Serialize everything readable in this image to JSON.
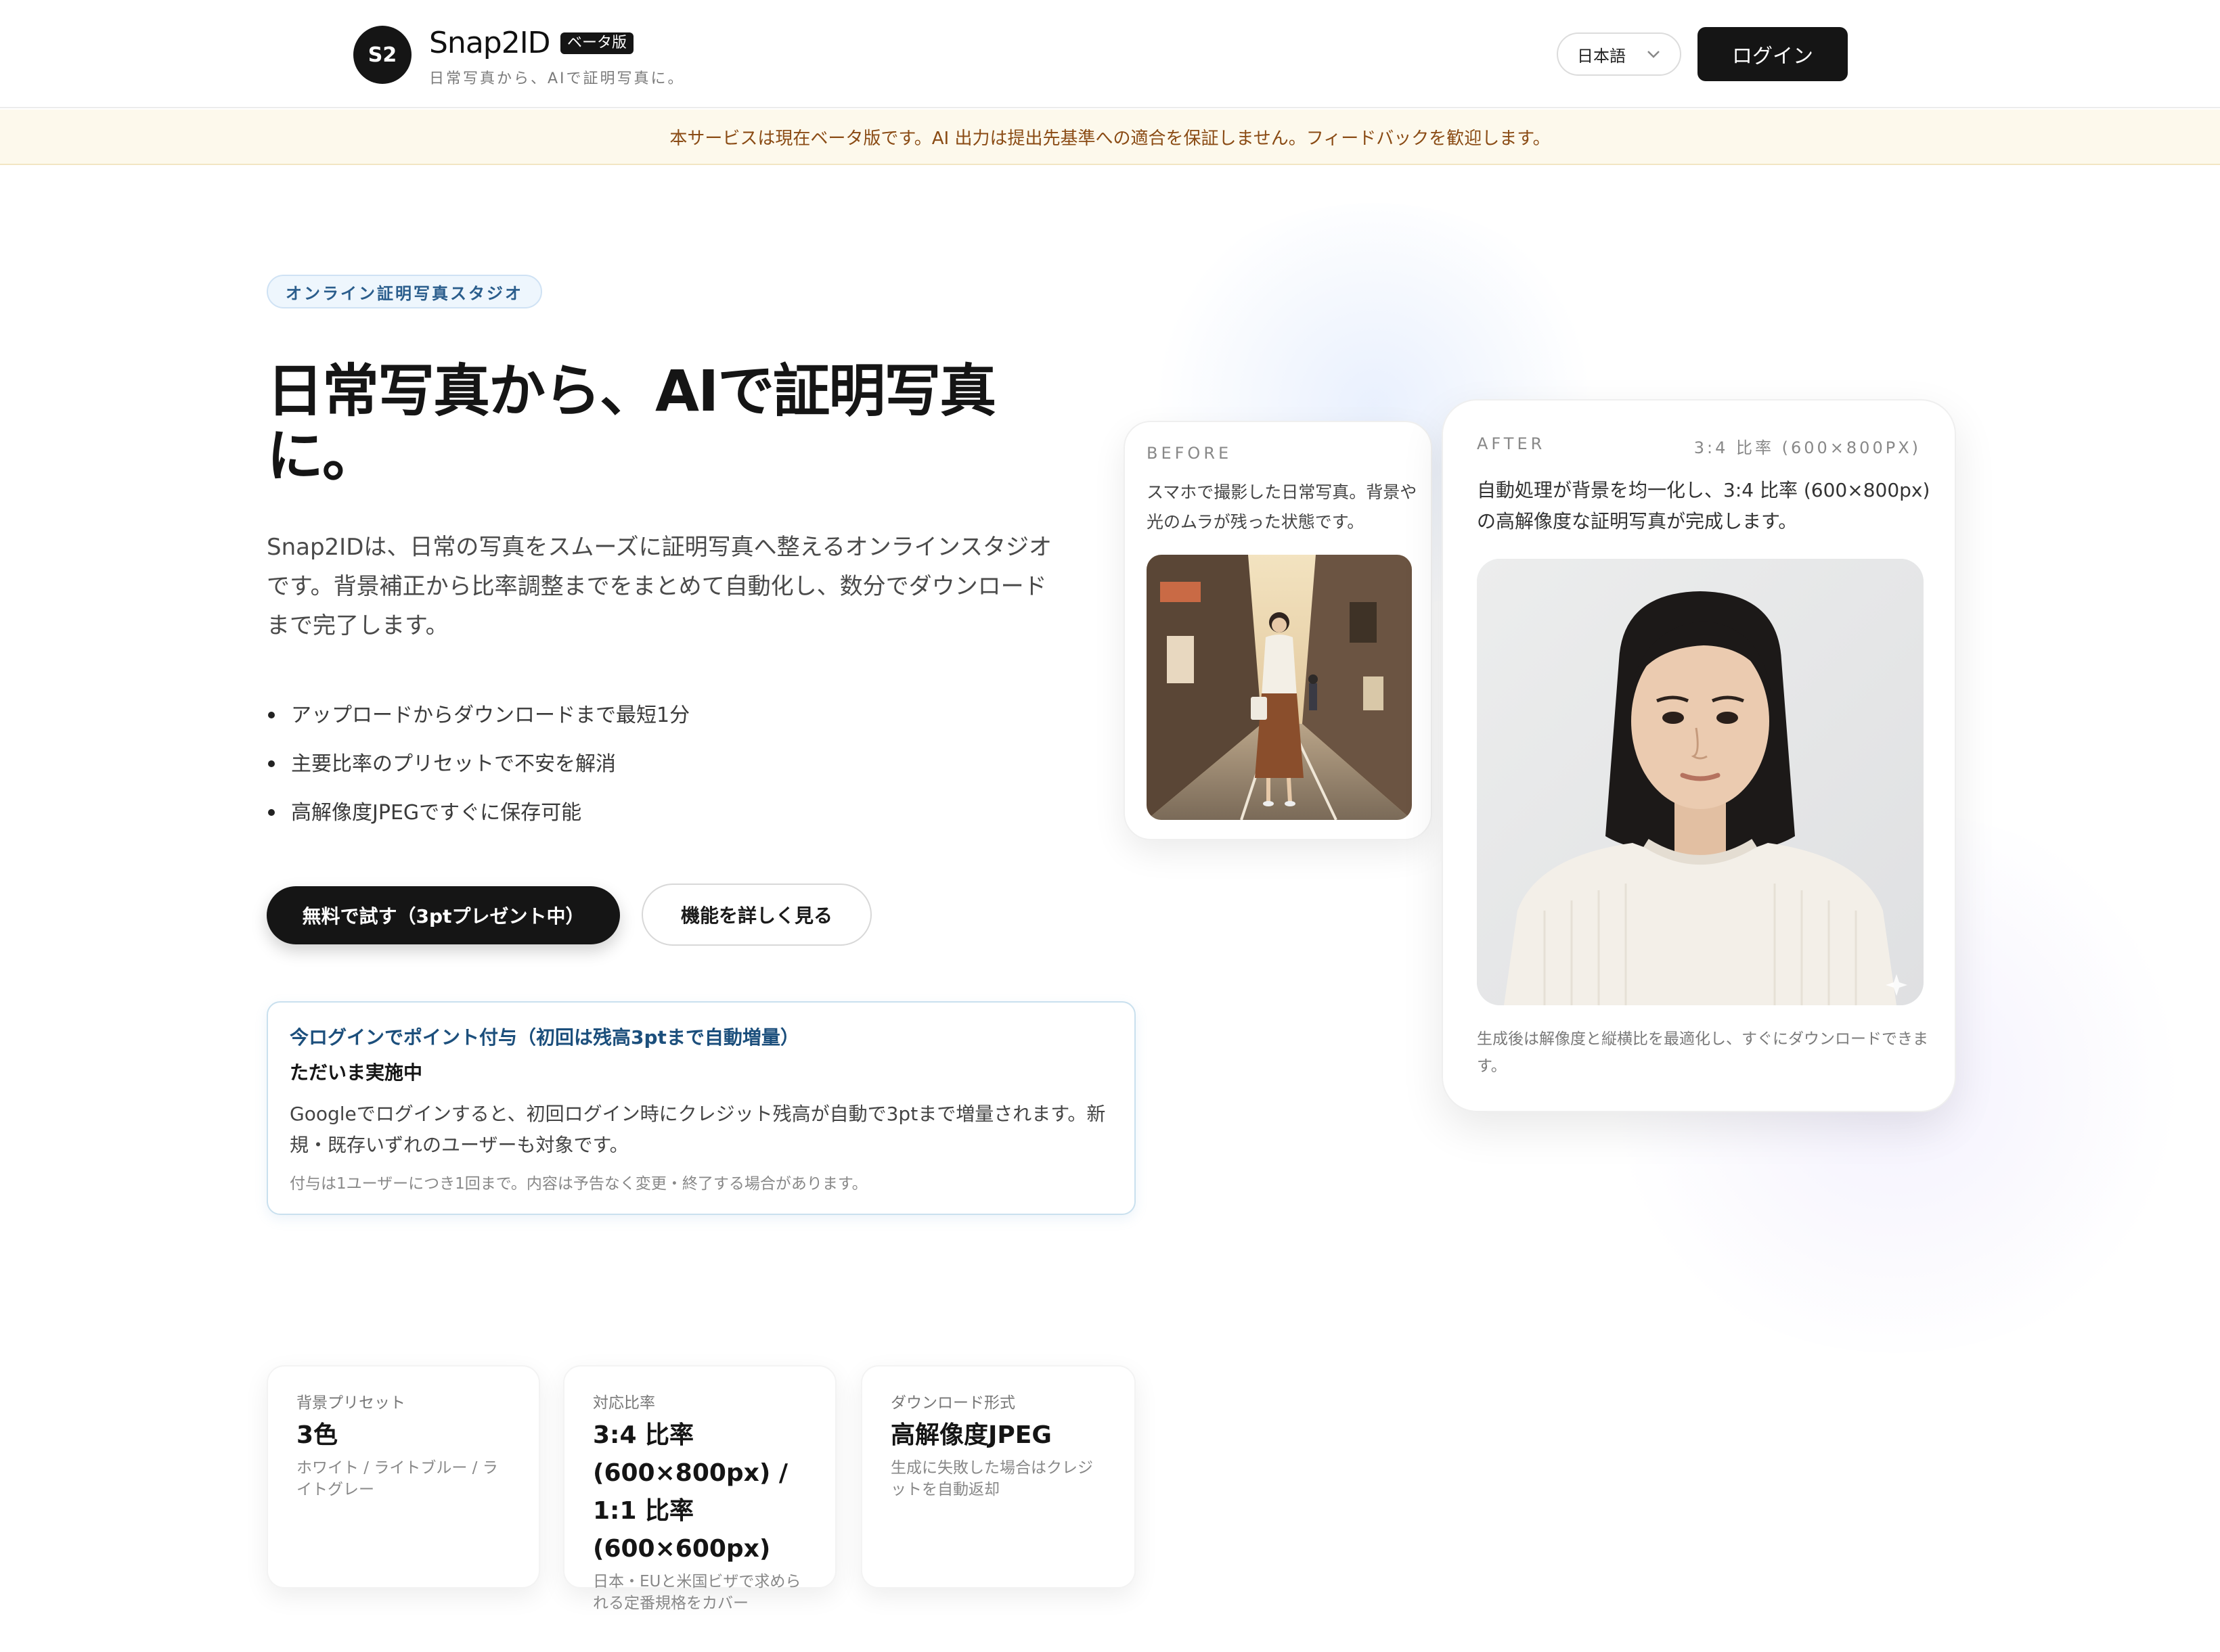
{
  "header": {
    "logo_text": "S2",
    "brand": "Snap2ID",
    "badge": "ベータ版",
    "tagline": "日常写真から、AIで証明写真に。",
    "language": "日本語",
    "login": "ログイン"
  },
  "banner": {
    "text": "本サービスは現在ベータ版です。AI 出力は提出先基準への適合を保証しません。フィードバックを歓迎します。"
  },
  "hero": {
    "eyebrow": "オンライン証明写真スタジオ",
    "title": "日常写真から、AIで証明写真に。",
    "description": "Snap2IDは、日常の写真をスムーズに証明写真へ整えるオンラインスタジオです。背景補正から比率調整までをまとめて自動化し、数分でダウンロードまで完了します。",
    "bullets": [
      "アップロードからダウンロードまで最短1分",
      "主要比率のプリセットで不安を解消",
      "高解像度JPEGですぐに保存可能"
    ],
    "cta_primary": "無料で試す（3ptプレゼント中）",
    "cta_secondary": "機能を詳しく見る"
  },
  "promo": {
    "title": "今ログインでポイント付与（初回は残高3ptまで自動増量）",
    "subtitle": "ただいま実施中",
    "body": "Googleでログインすると、初回ログイン時にクレジット残高が自動で3ptまで増量されます。新規・既存いずれのユーザーも対象です。",
    "note": "付与は1ユーザーにつき1回まで。内容は予告なく変更・終了する場合があります。"
  },
  "before": {
    "label": "BEFORE",
    "description": "スマホで撮影した日常写真。背景や光のムラが残った状態です。"
  },
  "after": {
    "label": "AFTER",
    "ratio": "3:4 比率 (600×800PX)",
    "description": "自動処理が背景を均一化し、3:4 比率 (600×800px) の高解像度な証明写真が完成します。",
    "footnote": "生成後は解像度と縦横比を最適化し、すぐにダウンロードできます。"
  },
  "stats": [
    {
      "label": "背景プリセット",
      "value": "3色",
      "note": "ホワイト / ライトブルー / ライトグレー"
    },
    {
      "label": "対応比率",
      "value": "3:4 比率 (600×800px) / 1:1 比率 (600×600px)",
      "note": "日本・EUと米国ビザで求められる定番規格をカバー"
    },
    {
      "label": "ダウンロード形式",
      "value": "高解像度JPEG",
      "note": "生成に失敗した場合はクレジットを自動返却"
    }
  ],
  "colors": {
    "primary": "#151515",
    "banner_bg": "#fdf9ec",
    "banner_text": "#8a4b14",
    "accent_blue": "#1c4f7c"
  }
}
